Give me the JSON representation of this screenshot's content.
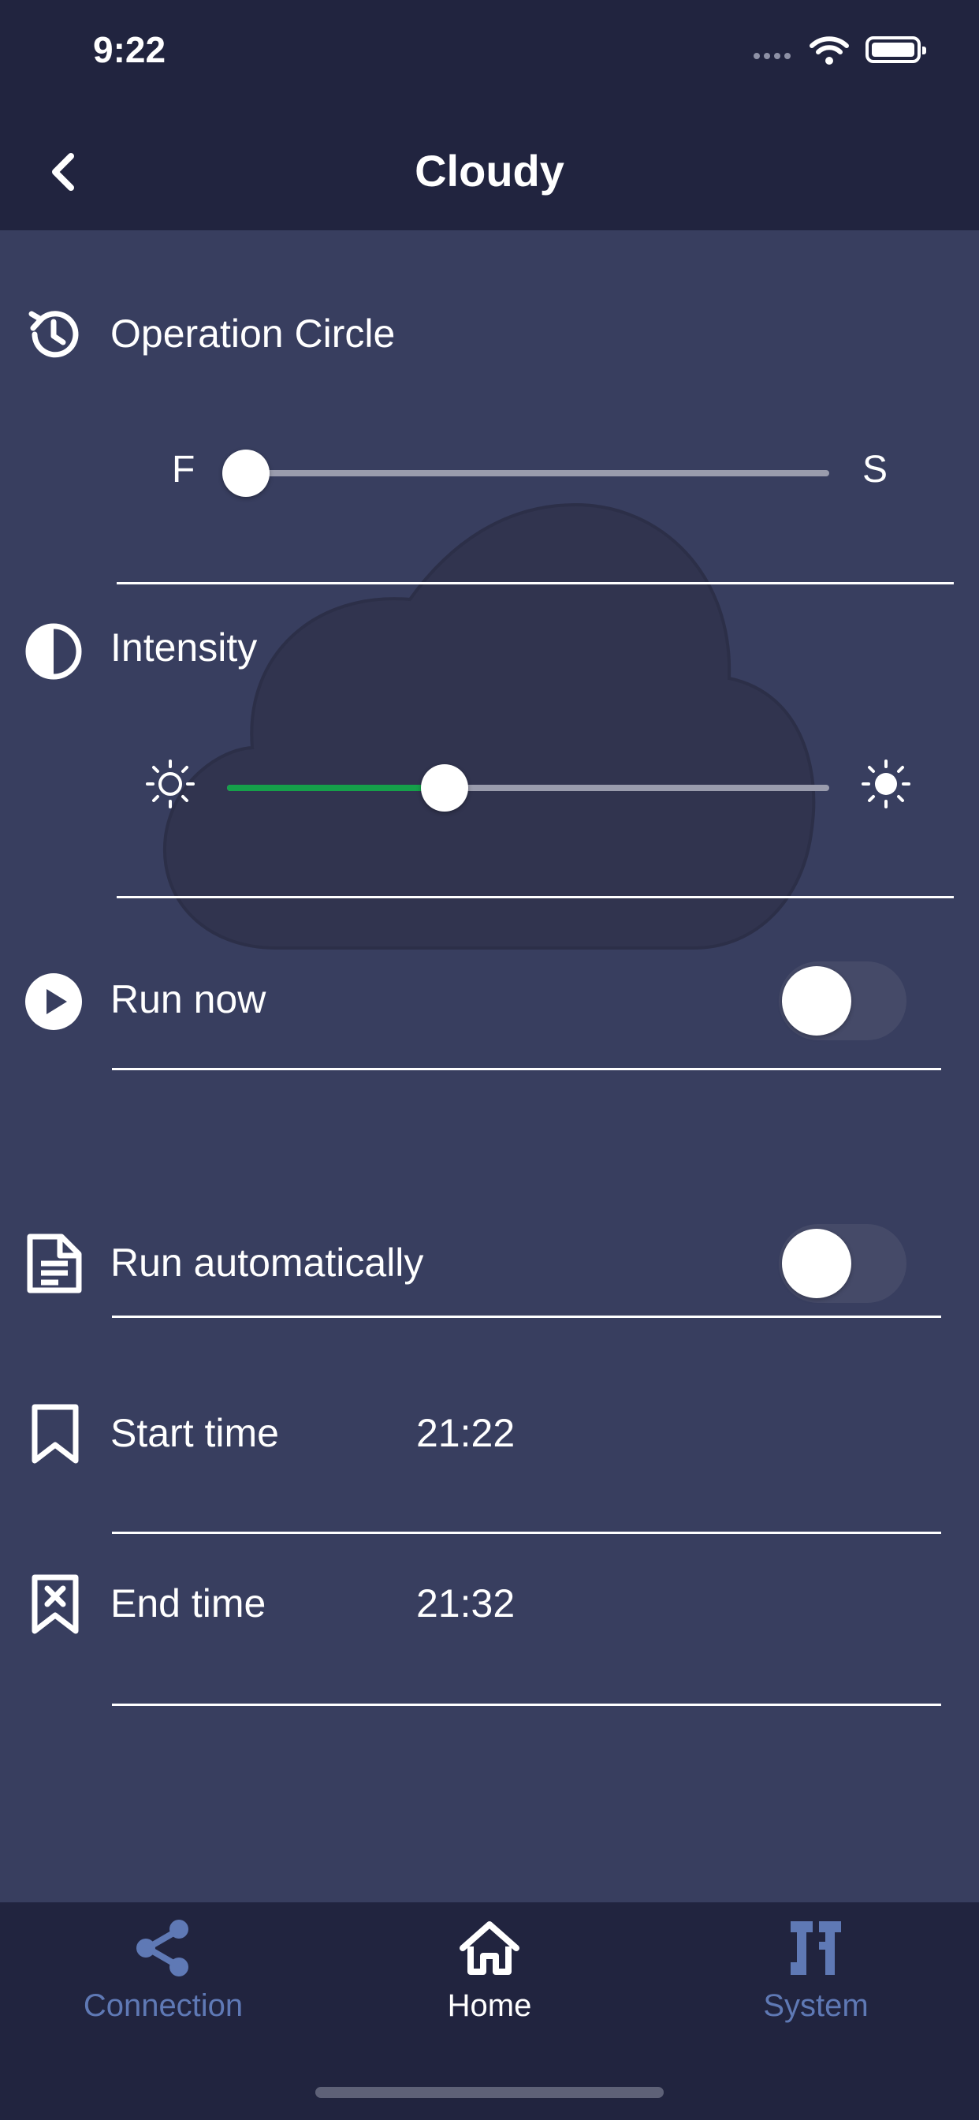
{
  "status_bar": {
    "time": "9:22"
  },
  "nav": {
    "title": "Cloudy"
  },
  "operation_circle": {
    "label": "Operation Circle",
    "min_label": "F",
    "max_label": "S",
    "value_fraction": 0.0
  },
  "intensity": {
    "label": "Intensity",
    "min_icon": "sun-outline-icon",
    "max_icon": "sun-filled-icon",
    "value_fraction": 0.36
  },
  "run_now": {
    "label": "Run now",
    "enabled": false
  },
  "run_automatically": {
    "label": "Run automatically",
    "enabled": false
  },
  "start_time": {
    "label": "Start time",
    "value": "21:22"
  },
  "end_time": {
    "label": "End time",
    "value": "21:32"
  },
  "tabbar": {
    "tabs": [
      {
        "label": "Connection",
        "icon": "share-icon",
        "active": false
      },
      {
        "label": "Home",
        "icon": "home-icon",
        "active": true
      },
      {
        "label": "System",
        "icon": "tools-icon",
        "active": false
      }
    ]
  },
  "colors": {
    "background": "#383e5f",
    "bar": "#21243f",
    "accent_green": "#15a04a",
    "inactive_tab": "#5f79b5"
  }
}
